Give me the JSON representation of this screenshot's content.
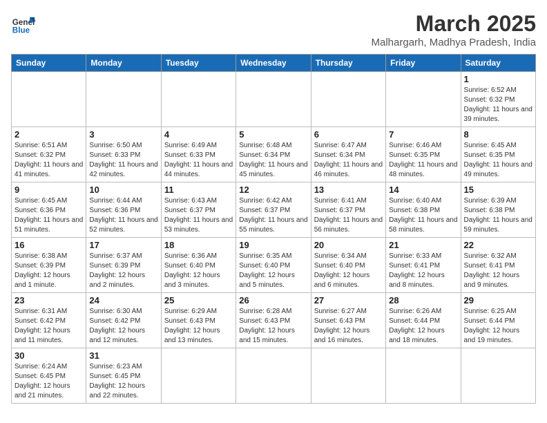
{
  "header": {
    "logo_general": "General",
    "logo_blue": "Blue",
    "month_title": "March 2025",
    "subtitle": "Malhargarh, Madhya Pradesh, India"
  },
  "weekdays": [
    "Sunday",
    "Monday",
    "Tuesday",
    "Wednesday",
    "Thursday",
    "Friday",
    "Saturday"
  ],
  "weeks": [
    [
      {
        "day": "",
        "info": ""
      },
      {
        "day": "",
        "info": ""
      },
      {
        "day": "",
        "info": ""
      },
      {
        "day": "",
        "info": ""
      },
      {
        "day": "",
        "info": ""
      },
      {
        "day": "",
        "info": ""
      },
      {
        "day": "1",
        "info": "Sunrise: 6:52 AM\nSunset: 6:32 PM\nDaylight: 11 hours and 39 minutes."
      }
    ],
    [
      {
        "day": "2",
        "info": "Sunrise: 6:51 AM\nSunset: 6:32 PM\nDaylight: 11 hours and 41 minutes."
      },
      {
        "day": "3",
        "info": "Sunrise: 6:50 AM\nSunset: 6:33 PM\nDaylight: 11 hours and 42 minutes."
      },
      {
        "day": "4",
        "info": "Sunrise: 6:49 AM\nSunset: 6:33 PM\nDaylight: 11 hours and 44 minutes."
      },
      {
        "day": "5",
        "info": "Sunrise: 6:48 AM\nSunset: 6:34 PM\nDaylight: 11 hours and 45 minutes."
      },
      {
        "day": "6",
        "info": "Sunrise: 6:47 AM\nSunset: 6:34 PM\nDaylight: 11 hours and 46 minutes."
      },
      {
        "day": "7",
        "info": "Sunrise: 6:46 AM\nSunset: 6:35 PM\nDaylight: 11 hours and 48 minutes."
      },
      {
        "day": "8",
        "info": "Sunrise: 6:45 AM\nSunset: 6:35 PM\nDaylight: 11 hours and 49 minutes."
      }
    ],
    [
      {
        "day": "9",
        "info": "Sunrise: 6:45 AM\nSunset: 6:36 PM\nDaylight: 11 hours and 51 minutes."
      },
      {
        "day": "10",
        "info": "Sunrise: 6:44 AM\nSunset: 6:36 PM\nDaylight: 11 hours and 52 minutes."
      },
      {
        "day": "11",
        "info": "Sunrise: 6:43 AM\nSunset: 6:37 PM\nDaylight: 11 hours and 53 minutes."
      },
      {
        "day": "12",
        "info": "Sunrise: 6:42 AM\nSunset: 6:37 PM\nDaylight: 11 hours and 55 minutes."
      },
      {
        "day": "13",
        "info": "Sunrise: 6:41 AM\nSunset: 6:37 PM\nDaylight: 11 hours and 56 minutes."
      },
      {
        "day": "14",
        "info": "Sunrise: 6:40 AM\nSunset: 6:38 PM\nDaylight: 11 hours and 58 minutes."
      },
      {
        "day": "15",
        "info": "Sunrise: 6:39 AM\nSunset: 6:38 PM\nDaylight: 11 hours and 59 minutes."
      }
    ],
    [
      {
        "day": "16",
        "info": "Sunrise: 6:38 AM\nSunset: 6:39 PM\nDaylight: 12 hours and 1 minute."
      },
      {
        "day": "17",
        "info": "Sunrise: 6:37 AM\nSunset: 6:39 PM\nDaylight: 12 hours and 2 minutes."
      },
      {
        "day": "18",
        "info": "Sunrise: 6:36 AM\nSunset: 6:40 PM\nDaylight: 12 hours and 3 minutes."
      },
      {
        "day": "19",
        "info": "Sunrise: 6:35 AM\nSunset: 6:40 PM\nDaylight: 12 hours and 5 minutes."
      },
      {
        "day": "20",
        "info": "Sunrise: 6:34 AM\nSunset: 6:40 PM\nDaylight: 12 hours and 6 minutes."
      },
      {
        "day": "21",
        "info": "Sunrise: 6:33 AM\nSunset: 6:41 PM\nDaylight: 12 hours and 8 minutes."
      },
      {
        "day": "22",
        "info": "Sunrise: 6:32 AM\nSunset: 6:41 PM\nDaylight: 12 hours and 9 minutes."
      }
    ],
    [
      {
        "day": "23",
        "info": "Sunrise: 6:31 AM\nSunset: 6:42 PM\nDaylight: 12 hours and 11 minutes."
      },
      {
        "day": "24",
        "info": "Sunrise: 6:30 AM\nSunset: 6:42 PM\nDaylight: 12 hours and 12 minutes."
      },
      {
        "day": "25",
        "info": "Sunrise: 6:29 AM\nSunset: 6:43 PM\nDaylight: 12 hours and 13 minutes."
      },
      {
        "day": "26",
        "info": "Sunrise: 6:28 AM\nSunset: 6:43 PM\nDaylight: 12 hours and 15 minutes."
      },
      {
        "day": "27",
        "info": "Sunrise: 6:27 AM\nSunset: 6:43 PM\nDaylight: 12 hours and 16 minutes."
      },
      {
        "day": "28",
        "info": "Sunrise: 6:26 AM\nSunset: 6:44 PM\nDaylight: 12 hours and 18 minutes."
      },
      {
        "day": "29",
        "info": "Sunrise: 6:25 AM\nSunset: 6:44 PM\nDaylight: 12 hours and 19 minutes."
      }
    ],
    [
      {
        "day": "30",
        "info": "Sunrise: 6:24 AM\nSunset: 6:45 PM\nDaylight: 12 hours and 21 minutes."
      },
      {
        "day": "31",
        "info": "Sunrise: 6:23 AM\nSunset: 6:45 PM\nDaylight: 12 hours and 22 minutes."
      },
      {
        "day": "",
        "info": ""
      },
      {
        "day": "",
        "info": ""
      },
      {
        "day": "",
        "info": ""
      },
      {
        "day": "",
        "info": ""
      },
      {
        "day": "",
        "info": ""
      }
    ]
  ]
}
